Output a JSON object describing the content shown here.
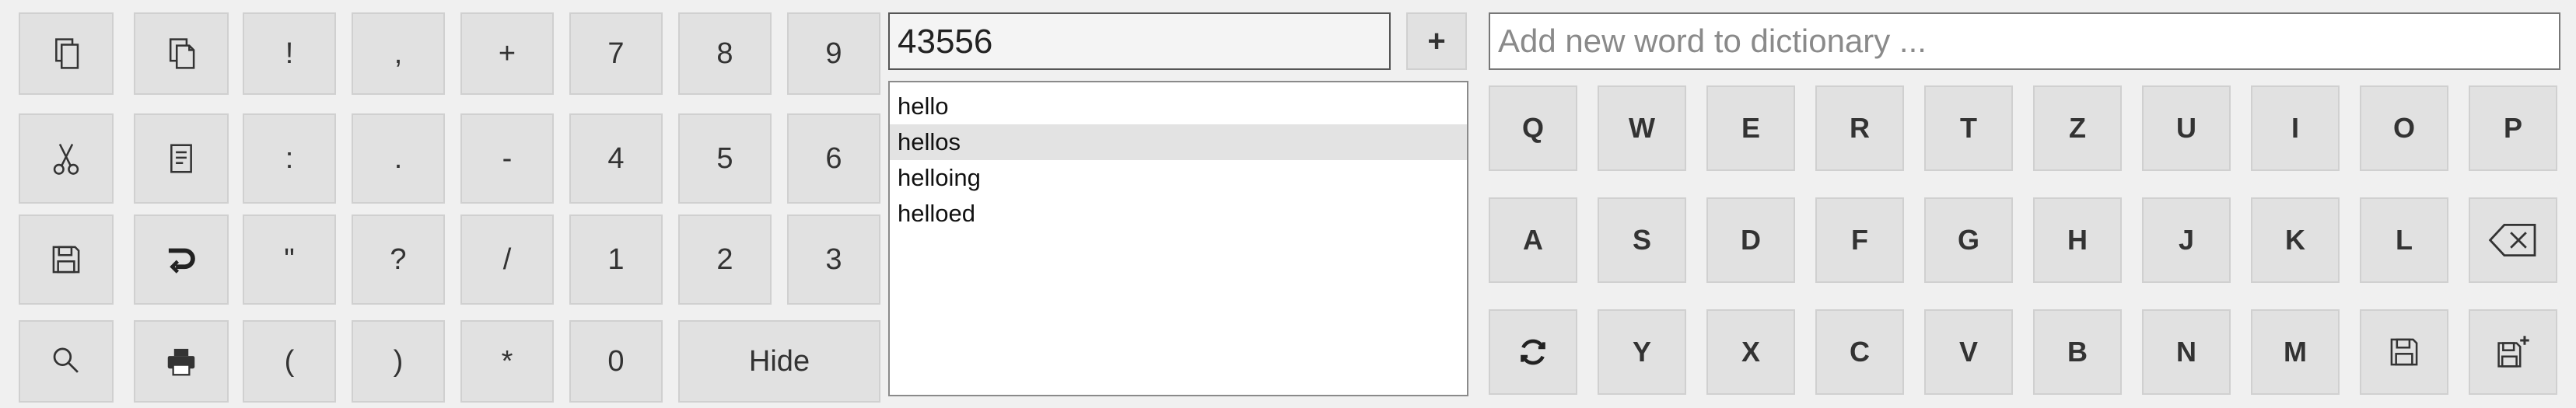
{
  "number_input": {
    "value": "43556"
  },
  "add_label": "+",
  "dictionary_input": {
    "placeholder": "Add new word to dictionary ..."
  },
  "suggestions": [
    "hello",
    "hellos",
    "helloing",
    "helloed"
  ],
  "selected_suggestion": "hellos",
  "symbols": {
    "exclaim": "!",
    "comma": ",",
    "plus": "+",
    "colon": ":",
    "period": ".",
    "minus": "-",
    "quote": "\"",
    "question": "?",
    "slash": "/",
    "lparen": "(",
    "rparen": ")",
    "asterisk": "*"
  },
  "digits": [
    "7",
    "8",
    "9",
    "4",
    "5",
    "6",
    "1",
    "2",
    "3",
    "0"
  ],
  "hide_label": "Hide",
  "letters": {
    "row1": [
      "Q",
      "W",
      "E",
      "R",
      "T",
      "Z",
      "U",
      "I",
      "O",
      "P"
    ],
    "row2": [
      "A",
      "S",
      "D",
      "F",
      "G",
      "H",
      "J",
      "K",
      "L"
    ],
    "row3": [
      "Y",
      "X",
      "C",
      "V",
      "B",
      "N",
      "M"
    ]
  },
  "icons": {
    "copy": "copy-icon",
    "copy_alt": "copy-doc-icon",
    "cut": "scissors-icon",
    "paste": "clipboard-icon",
    "save": "floppy-disk-icon",
    "undo": "undo-icon",
    "search": "search-icon",
    "print": "printer-icon",
    "backspace": "backspace-icon",
    "refresh": "refresh-icon",
    "save_dict": "floppy-disk-icon",
    "save_new": "floppy-disk-plus-icon"
  }
}
